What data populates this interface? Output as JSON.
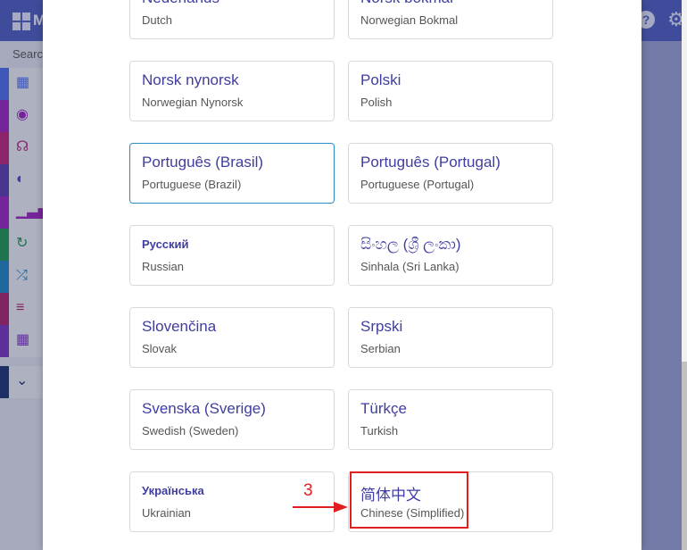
{
  "background": {
    "logo_text": "M",
    "search_placeholder": "Searc",
    "help_icon": "?",
    "gear_icon": "⚙",
    "sidebar_icons": [
      {
        "name": "grid-icon",
        "glyph": "▦",
        "color": "#4a6cf0"
      },
      {
        "name": "target-icon",
        "glyph": "◉",
        "color": "#a020c0"
      },
      {
        "name": "headphones-icon",
        "glyph": "☊",
        "color": "#c0207a"
      },
      {
        "name": "toggle-icon",
        "glyph": "◐",
        "color": "#5a3ab0"
      },
      {
        "name": "signal-icon",
        "glyph": "▁▃▅",
        "color": "#a020c0"
      },
      {
        "name": "refresh-icon",
        "glyph": "↻",
        "color": "#1a9a4a"
      },
      {
        "name": "shuffle-icon",
        "glyph": "⤮",
        "color": "#1a88c8"
      },
      {
        "name": "list-icon",
        "glyph": "≡",
        "color": "#b0206a"
      },
      {
        "name": "calculator-icon",
        "glyph": "▦",
        "color": "#7a30c0"
      },
      {
        "name": "chevron-down-icon",
        "glyph": "⌄",
        "color": "#1a3070"
      }
    ]
  },
  "languages": [
    {
      "name": "Nederlands",
      "english": "Dutch"
    },
    {
      "name": "Norsk bokmål",
      "english": "Norwegian Bokmal"
    },
    {
      "name": "Norsk nynorsk",
      "english": "Norwegian Nynorsk"
    },
    {
      "name": "Polski",
      "english": "Polish"
    },
    {
      "name": "Português (Brasil)",
      "english": "Portuguese (Brazil)",
      "selected": true
    },
    {
      "name": "Português (Portugal)",
      "english": "Portuguese (Portugal)"
    },
    {
      "name": "Русский",
      "english": "Russian"
    },
    {
      "name": "සිංහල (ශ්‍රී ලංකා)",
      "english": "Sinhala (Sri Lanka)"
    },
    {
      "name": "Slovenčina",
      "english": "Slovak"
    },
    {
      "name": "Srpski",
      "english": "Serbian"
    },
    {
      "name": "Svenska (Sverige)",
      "english": "Swedish (Sweden)"
    },
    {
      "name": "Türkçe",
      "english": "Turkish"
    },
    {
      "name": "Українська",
      "english": "Ukrainian"
    },
    {
      "name": "简体中文",
      "english": "Chinese (Simplified)"
    }
  ],
  "annotation": {
    "step_number": "3",
    "color": "#e02020"
  },
  "colors": {
    "accent": "#3f3da0",
    "selected_border": "#2a8ec7",
    "header": "#4b5cc4"
  }
}
